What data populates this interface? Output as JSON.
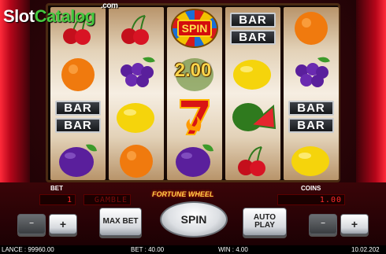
{
  "site_logo": {
    "part1": "Slot",
    "part2": "Catalog",
    "suffix": ".com"
  },
  "reels": {
    "win_amount": "2.00",
    "bar_label": "BAR",
    "spin_symbol_label": "SPIN",
    "symbols": [
      [
        "cherry",
        "orange",
        "bar-double",
        "plum"
      ],
      [
        "cherry",
        "grapes",
        "lemon",
        "orange"
      ],
      [
        "spin-wheel",
        "melon",
        "seven",
        "plum"
      ],
      [
        "bar-double",
        "lemon",
        "watermelon",
        "cherry"
      ],
      [
        "orange",
        "grapes",
        "bar-double",
        "lemon"
      ]
    ]
  },
  "panel": {
    "bet_label": "BET",
    "coins_label": "COINS",
    "bet_led": "1",
    "gamble_led": "GAMBLE",
    "coins_led": "1.00",
    "game_title": "FORTUNE WHEEL",
    "max_bet_label": "MAX BET",
    "spin_label": "SPIN",
    "auto_play_label": "AUTO PLAY",
    "minus_label": "−",
    "plus_label": "+"
  },
  "status": {
    "balance": "LANCE : 99960.00",
    "bet": "BET : 40.00",
    "win": "WIN : 4.00",
    "time": "10.02.202"
  },
  "colors": {
    "led_red": "#ff2a2a",
    "logo_green": "#45c83e",
    "win_gold": "#ffd54a"
  }
}
